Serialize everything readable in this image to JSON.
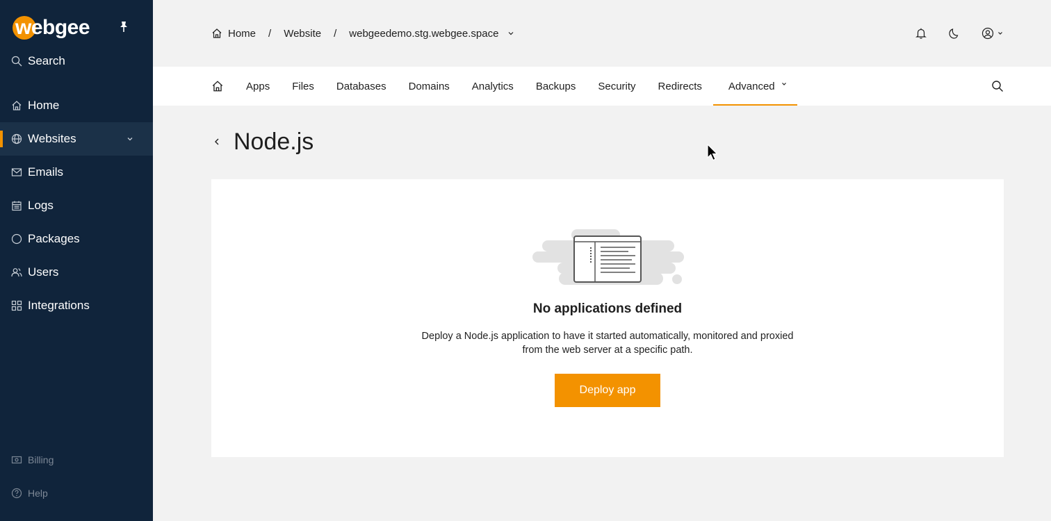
{
  "app": {
    "logo_text": "webgee",
    "accent_color": "#f39200",
    "sidebar_color": "#10243b"
  },
  "sidebar": {
    "search_label": "Search",
    "items": [
      {
        "label": "Home",
        "icon": "home-icon"
      },
      {
        "label": "Websites",
        "icon": "globe-icon",
        "active": true
      },
      {
        "label": "Emails",
        "icon": "mail-icon"
      },
      {
        "label": "Logs",
        "icon": "calendar-icon"
      },
      {
        "label": "Packages",
        "icon": "circle-icon"
      },
      {
        "label": "Users",
        "icon": "users-icon"
      },
      {
        "label": "Integrations",
        "icon": "grid-icon"
      }
    ],
    "billing_label": "Billing",
    "help_label": "Help"
  },
  "breadcrumb": {
    "home": "Home",
    "website": "Website",
    "domain": "webgeedemo.stg.webgee.space"
  },
  "tabs": {
    "items": [
      "Apps",
      "Files",
      "Databases",
      "Domains",
      "Analytics",
      "Backups",
      "Security",
      "Redirects",
      "Advanced"
    ],
    "active": "Advanced"
  },
  "page": {
    "title": "Node.js"
  },
  "empty_state": {
    "title": "No applications defined",
    "description": "Deploy a Node.js application to have it started automatically, monitored and proxied from the web server at a specific path.",
    "button_label": "Deploy app"
  }
}
